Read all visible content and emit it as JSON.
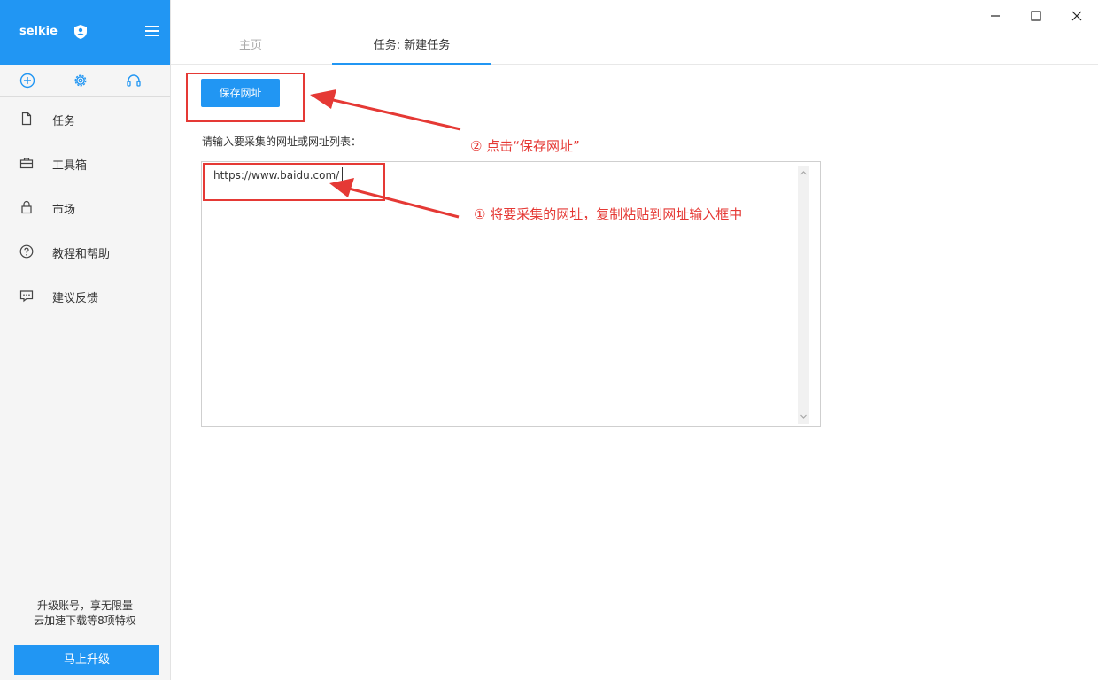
{
  "sidebar": {
    "brand": "selkie",
    "nav": [
      {
        "label": "任务",
        "icon": "file-icon"
      },
      {
        "label": "工具箱",
        "icon": "toolbox-icon"
      },
      {
        "label": "市场",
        "icon": "lock-icon"
      },
      {
        "label": "教程和帮助",
        "icon": "help-icon"
      },
      {
        "label": "建议反馈",
        "icon": "feedback-icon"
      }
    ],
    "quick_actions": [
      "add-icon",
      "gear-icon",
      "headset-icon"
    ],
    "promo_line1": "升级账号，享无限量",
    "promo_line2": "云加速下载等8项特权",
    "upgrade_label": "马上升级"
  },
  "tabs": [
    {
      "label": "主页",
      "active": false
    },
    {
      "label": "任务: 新建任务",
      "active": true
    }
  ],
  "main": {
    "save_button": "保存网址",
    "prompt": "请输入要采集的网址或网址列表：",
    "url_value": "https://www.baidu.com/"
  },
  "annotations": {
    "step2": "② 点击“保存网址”",
    "step1": "① 将要采集的网址，复制粘贴到网址输入框中"
  },
  "colors": {
    "accent": "#2196f3",
    "annotation": "#e53935",
    "sidebar_bg": "#f5f5f5"
  }
}
